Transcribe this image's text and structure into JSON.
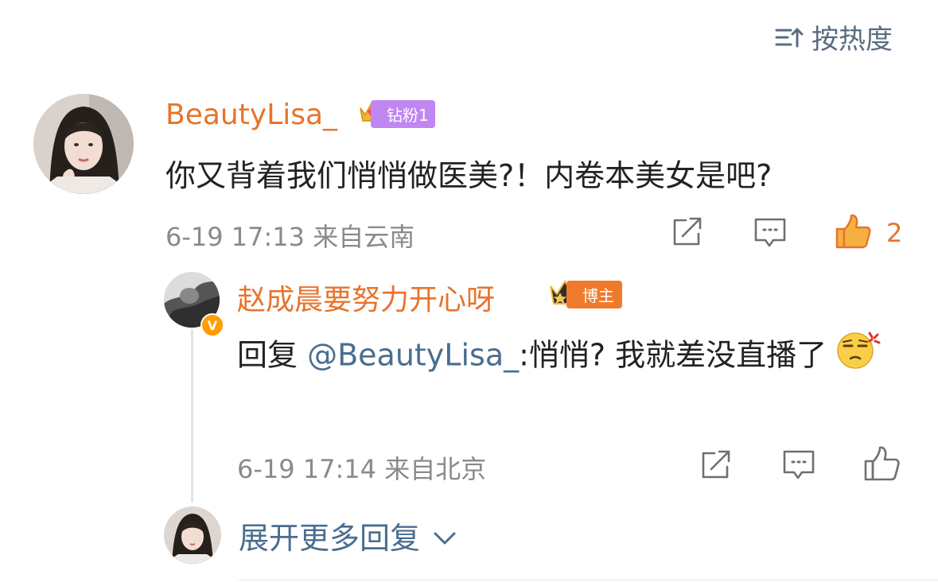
{
  "sort": {
    "label": "按热度",
    "icon": "sort-icon"
  },
  "comment": {
    "username": "BeautyLisa_",
    "badge": {
      "icon": "crown-icon",
      "label": "钻粉1"
    },
    "text": "你又背着我们悄悄做医美?！内卷本美女是吧?",
    "meta": "6-19 17:13 来自云南",
    "actions": {
      "share_icon": "share-icon",
      "reply_icon": "comment-icon",
      "like_icon": "like-icon",
      "like_count": "2"
    },
    "colors": {
      "username": "#e8732b",
      "like": "#e8732b"
    }
  },
  "reply": {
    "username": "赵成晨要努力开心呀",
    "verified_icon": "verified-v-icon",
    "badge": {
      "icon": "crown-icon",
      "label": "博主"
    },
    "prefix": "回复 ",
    "mention": "@BeautyLisa_",
    "text": ":悄悄? 我就差没直播了",
    "emoji": "annoyed-face-emoji",
    "meta": "6-19 17:14 来自北京",
    "actions": {
      "share_icon": "share-icon",
      "reply_icon": "comment-icon",
      "like_icon": "like-icon"
    }
  },
  "expand": {
    "label": "展开更多回复",
    "icon": "chevron-down-icon"
  }
}
